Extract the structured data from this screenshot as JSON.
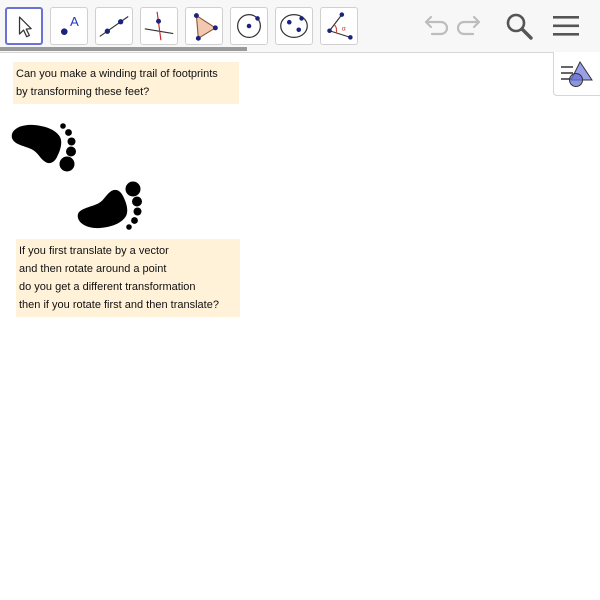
{
  "toolbar": {
    "tools": [
      {
        "name": "move-tool-icon",
        "active": true
      },
      {
        "name": "point-tool-icon",
        "active": false
      },
      {
        "name": "line-tool-icon",
        "active": false
      },
      {
        "name": "perpendicular-line-tool-icon",
        "active": false
      },
      {
        "name": "polygon-tool-icon",
        "active": false
      },
      {
        "name": "circle-tool-icon",
        "active": false
      },
      {
        "name": "ellipse-tool-icon",
        "active": false
      },
      {
        "name": "angle-tool-icon",
        "active": false
      }
    ],
    "point_tool_letter": "A",
    "angle_tool_letter": "α"
  },
  "text1": {
    "lines": [
      "Can you make a winding trail of footprints",
      "by transforming these feet?"
    ]
  },
  "text2": {
    "lines": [
      "If you first translate by a vector",
      "and then rotate around a point",
      "do you get a different transformation",
      "then if you rotate first and then translate?"
    ]
  },
  "colors": {
    "accent": "#6b72d6",
    "textbox_bg": "#fff2d9",
    "foot": "#000000"
  }
}
